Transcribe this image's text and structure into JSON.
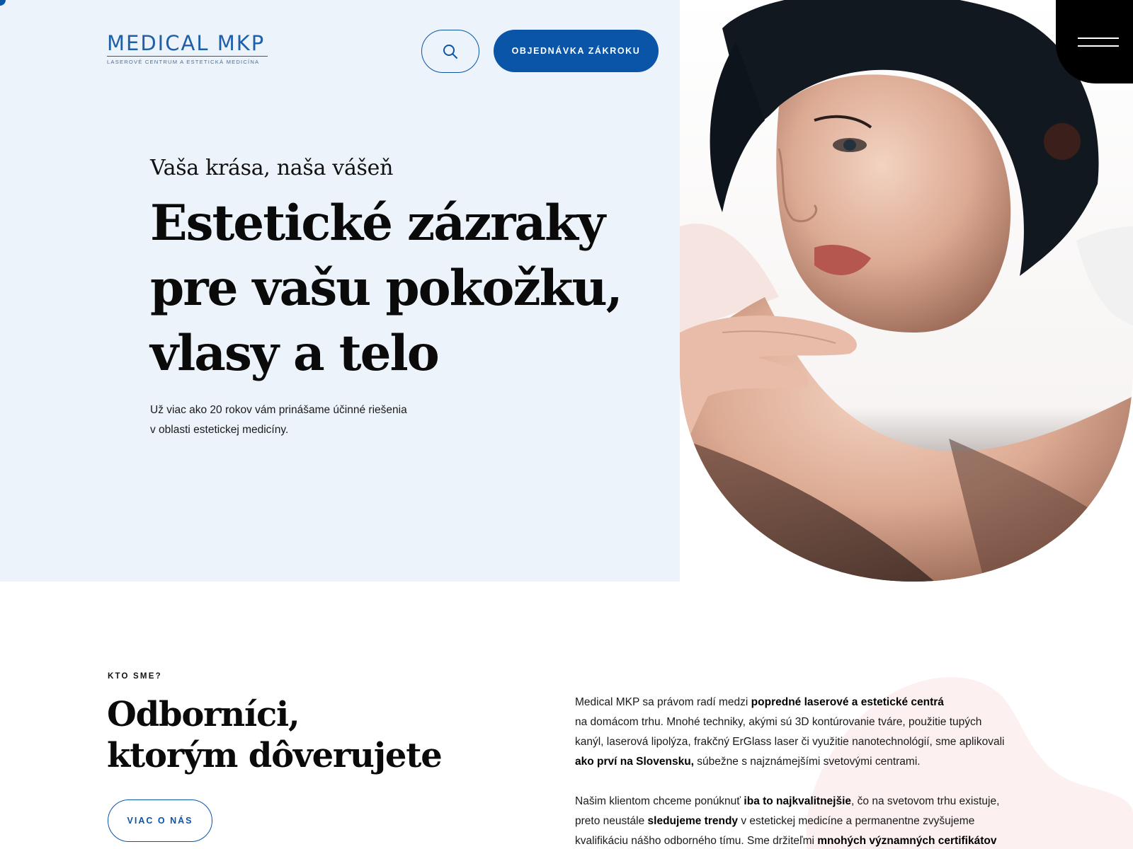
{
  "header": {
    "logo_title": "MEDICAL MKP",
    "logo_subtitle": "LASEROVÉ CENTRUM A ESTETICKÁ MEDICÍNA",
    "search_icon": "search-icon",
    "order_button": "OBJEDNÁVKA ZÁKROKU",
    "menu_icon": "hamburger-menu-icon"
  },
  "hero": {
    "tagline": "Vaša krása, naša vášeň",
    "title_lines": [
      "Estetické zázraky",
      "pre vašu pokožku,",
      "vlasy a telo"
    ],
    "description_lines": [
      "Už viac ako 20 rokov vám prinášame účinné riešenia",
      "v oblasti estetickej medicíny."
    ]
  },
  "about": {
    "eyebrow": "KTO SME?",
    "title_lines": [
      "Odborníci,",
      "ktorým dôverujete"
    ],
    "button": "VIAC O NÁS",
    "paragraph1": [
      [
        {
          "t": "Medical MKP sa právom radí medzi "
        },
        {
          "t": "popredné laserové a estetické centrá",
          "b": true
        }
      ],
      [
        {
          "t": "na domácom trhu. Mnohé techniky, akými sú 3D kontúrovanie tváre, použitie tupých"
        }
      ],
      [
        {
          "t": "kanýl, laserová lipolýza, frakčný ErGlass laser či využitie nanotechnológií, sme aplikovali"
        }
      ],
      [
        {
          "t": "ako prví na Slovensku,",
          "b": true
        },
        {
          "t": " súbežne s najznámejšími svetovými centrami."
        }
      ]
    ],
    "paragraph2": [
      [
        {
          "t": "Našim klientom chceme ponúknuť "
        },
        {
          "t": "iba to najkvalitnejšie",
          "b": true
        },
        {
          "t": ", čo na svetovom trhu existuje,"
        }
      ],
      [
        {
          "t": "preto neustále "
        },
        {
          "t": "sledujeme trendy",
          "b": true
        },
        {
          "t": " v estetickej medicíne a permanentne zvyšujeme"
        }
      ],
      [
        {
          "t": "kvalifikáciu nášho odborného tímu. Sme držiteľmi "
        },
        {
          "t": "mnohých významných certifikátov",
          "b": true
        }
      ]
    ]
  },
  "colors": {
    "brand_blue": "#0a55a8",
    "hero_background": "#ecf3fa",
    "menu_background": "#000000"
  }
}
